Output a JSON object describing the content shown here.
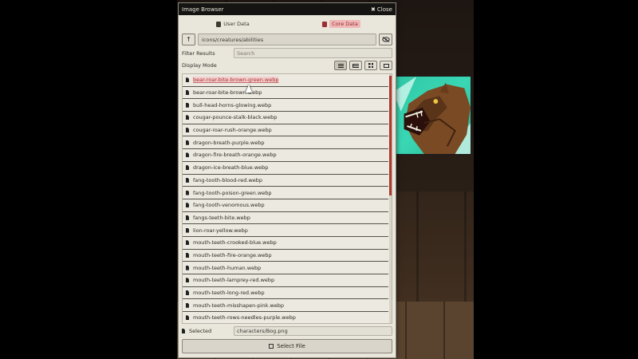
{
  "dialog": {
    "title": "Image Browser",
    "close_label": "Close"
  },
  "tabs": [
    {
      "label": "User Data",
      "active": false
    },
    {
      "label": "Core Data",
      "active": true
    }
  ],
  "path": {
    "up_icon": "arrow-up-icon",
    "value": "icons/creatures/abilities",
    "visibility_icon": "eye-slash-icon"
  },
  "filter": {
    "label": "Filter Results",
    "placeholder": "Search"
  },
  "display_mode": {
    "label": "Display Mode",
    "modes": [
      "lines",
      "list",
      "tiles",
      "images"
    ],
    "active_mode": "lines"
  },
  "files": [
    "bear-roar-bite-brown-green.webp",
    "bear-roar-bite-brown.webp",
    "bull-head-horns-glowing.webp",
    "cougar-pounce-stalk-black.webp",
    "cougar-roar-rush-orange.webp",
    "dragon-breath-purple.webp",
    "dragon-fire-breath-orange.webp",
    "dragon-ice-breath-blue.webp",
    "fang-tooth-blood-red.webp",
    "fang-tooth-poison-green.webp",
    "fang-tooth-venomous.webp",
    "fangs-teeth-bite.webp",
    "lion-roar-yellow.webp",
    "mouth-teeth-crooked-blue.webp",
    "mouth-teeth-fire-orange.webp",
    "mouth-teeth-human.webp",
    "mouth-teeth-lamprey-red.webp",
    "mouth-teeth-long-red.webp",
    "mouth-teeth-misshapen-pink.webp",
    "mouth-teeth-rows-needles-purple.webp"
  ],
  "selected_file_index": 0,
  "selected": {
    "label": "Selected",
    "value": "characters/Bog.png"
  },
  "select_button_label": "Select File",
  "colors": {
    "accent": "#b02a2a",
    "titlebar": "#151412",
    "panel": "#e9e6dc",
    "preview_bg": "#2fc7a6"
  }
}
